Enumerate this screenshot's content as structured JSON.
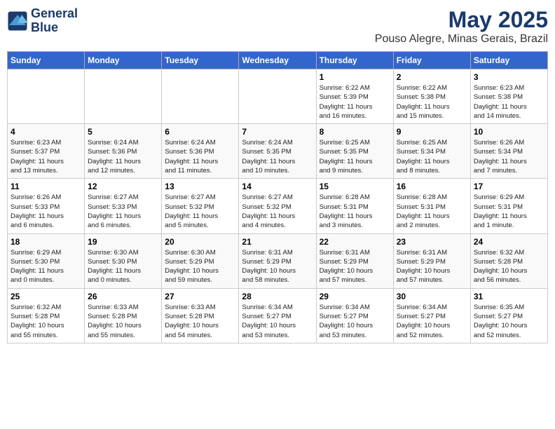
{
  "header": {
    "logo_line1": "General",
    "logo_line2": "Blue",
    "month": "May 2025",
    "location": "Pouso Alegre, Minas Gerais, Brazil"
  },
  "weekdays": [
    "Sunday",
    "Monday",
    "Tuesday",
    "Wednesday",
    "Thursday",
    "Friday",
    "Saturday"
  ],
  "weeks": [
    [
      {
        "day": "",
        "info": ""
      },
      {
        "day": "",
        "info": ""
      },
      {
        "day": "",
        "info": ""
      },
      {
        "day": "",
        "info": ""
      },
      {
        "day": "1",
        "info": "Sunrise: 6:22 AM\nSunset: 5:39 PM\nDaylight: 11 hours\nand 16 minutes."
      },
      {
        "day": "2",
        "info": "Sunrise: 6:22 AM\nSunset: 5:38 PM\nDaylight: 11 hours\nand 15 minutes."
      },
      {
        "day": "3",
        "info": "Sunrise: 6:23 AM\nSunset: 5:38 PM\nDaylight: 11 hours\nand 14 minutes."
      }
    ],
    [
      {
        "day": "4",
        "info": "Sunrise: 6:23 AM\nSunset: 5:37 PM\nDaylight: 11 hours\nand 13 minutes."
      },
      {
        "day": "5",
        "info": "Sunrise: 6:24 AM\nSunset: 5:36 PM\nDaylight: 11 hours\nand 12 minutes."
      },
      {
        "day": "6",
        "info": "Sunrise: 6:24 AM\nSunset: 5:36 PM\nDaylight: 11 hours\nand 11 minutes."
      },
      {
        "day": "7",
        "info": "Sunrise: 6:24 AM\nSunset: 5:35 PM\nDaylight: 11 hours\nand 10 minutes."
      },
      {
        "day": "8",
        "info": "Sunrise: 6:25 AM\nSunset: 5:35 PM\nDaylight: 11 hours\nand 9 minutes."
      },
      {
        "day": "9",
        "info": "Sunrise: 6:25 AM\nSunset: 5:34 PM\nDaylight: 11 hours\nand 8 minutes."
      },
      {
        "day": "10",
        "info": "Sunrise: 6:26 AM\nSunset: 5:34 PM\nDaylight: 11 hours\nand 7 minutes."
      }
    ],
    [
      {
        "day": "11",
        "info": "Sunrise: 6:26 AM\nSunset: 5:33 PM\nDaylight: 11 hours\nand 6 minutes."
      },
      {
        "day": "12",
        "info": "Sunrise: 6:27 AM\nSunset: 5:33 PM\nDaylight: 11 hours\nand 6 minutes."
      },
      {
        "day": "13",
        "info": "Sunrise: 6:27 AM\nSunset: 5:32 PM\nDaylight: 11 hours\nand 5 minutes."
      },
      {
        "day": "14",
        "info": "Sunrise: 6:27 AM\nSunset: 5:32 PM\nDaylight: 11 hours\nand 4 minutes."
      },
      {
        "day": "15",
        "info": "Sunrise: 6:28 AM\nSunset: 5:31 PM\nDaylight: 11 hours\nand 3 minutes."
      },
      {
        "day": "16",
        "info": "Sunrise: 6:28 AM\nSunset: 5:31 PM\nDaylight: 11 hours\nand 2 minutes."
      },
      {
        "day": "17",
        "info": "Sunrise: 6:29 AM\nSunset: 5:31 PM\nDaylight: 11 hours\nand 1 minute."
      }
    ],
    [
      {
        "day": "18",
        "info": "Sunrise: 6:29 AM\nSunset: 5:30 PM\nDaylight: 11 hours\nand 0 minutes."
      },
      {
        "day": "19",
        "info": "Sunrise: 6:30 AM\nSunset: 5:30 PM\nDaylight: 11 hours\nand 0 minutes."
      },
      {
        "day": "20",
        "info": "Sunrise: 6:30 AM\nSunset: 5:29 PM\nDaylight: 10 hours\nand 59 minutes."
      },
      {
        "day": "21",
        "info": "Sunrise: 6:31 AM\nSunset: 5:29 PM\nDaylight: 10 hours\nand 58 minutes."
      },
      {
        "day": "22",
        "info": "Sunrise: 6:31 AM\nSunset: 5:29 PM\nDaylight: 10 hours\nand 57 minutes."
      },
      {
        "day": "23",
        "info": "Sunrise: 6:31 AM\nSunset: 5:29 PM\nDaylight: 10 hours\nand 57 minutes."
      },
      {
        "day": "24",
        "info": "Sunrise: 6:32 AM\nSunset: 5:28 PM\nDaylight: 10 hours\nand 56 minutes."
      }
    ],
    [
      {
        "day": "25",
        "info": "Sunrise: 6:32 AM\nSunset: 5:28 PM\nDaylight: 10 hours\nand 55 minutes."
      },
      {
        "day": "26",
        "info": "Sunrise: 6:33 AM\nSunset: 5:28 PM\nDaylight: 10 hours\nand 55 minutes."
      },
      {
        "day": "27",
        "info": "Sunrise: 6:33 AM\nSunset: 5:28 PM\nDaylight: 10 hours\nand 54 minutes."
      },
      {
        "day": "28",
        "info": "Sunrise: 6:34 AM\nSunset: 5:27 PM\nDaylight: 10 hours\nand 53 minutes."
      },
      {
        "day": "29",
        "info": "Sunrise: 6:34 AM\nSunset: 5:27 PM\nDaylight: 10 hours\nand 53 minutes."
      },
      {
        "day": "30",
        "info": "Sunrise: 6:34 AM\nSunset: 5:27 PM\nDaylight: 10 hours\nand 52 minutes."
      },
      {
        "day": "31",
        "info": "Sunrise: 6:35 AM\nSunset: 5:27 PM\nDaylight: 10 hours\nand 52 minutes."
      }
    ]
  ]
}
